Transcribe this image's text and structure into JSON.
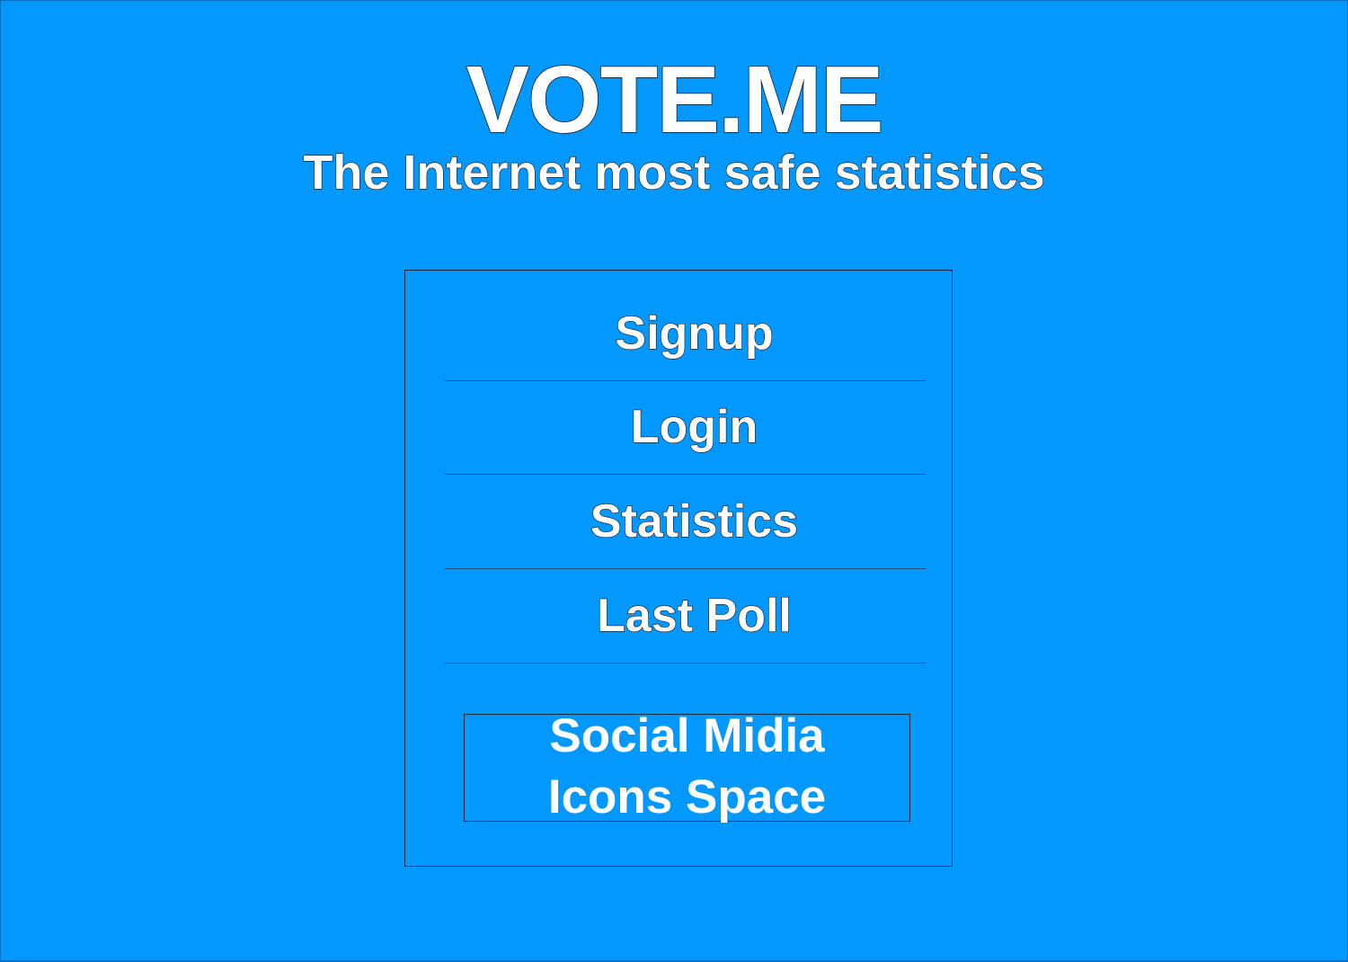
{
  "header": {
    "title": "VOTE.ME",
    "subtitle": "The Internet most safe statistics"
  },
  "menu": {
    "items": [
      {
        "label": "Signup"
      },
      {
        "label": "Login"
      },
      {
        "label": "Statistics"
      },
      {
        "label": "Last Poll"
      }
    ]
  },
  "social": {
    "line1": "Social Midia",
    "line2": "Icons Space"
  },
  "colors": {
    "background": "#0398fd",
    "text": "#ffffff",
    "outline": "#111111"
  }
}
